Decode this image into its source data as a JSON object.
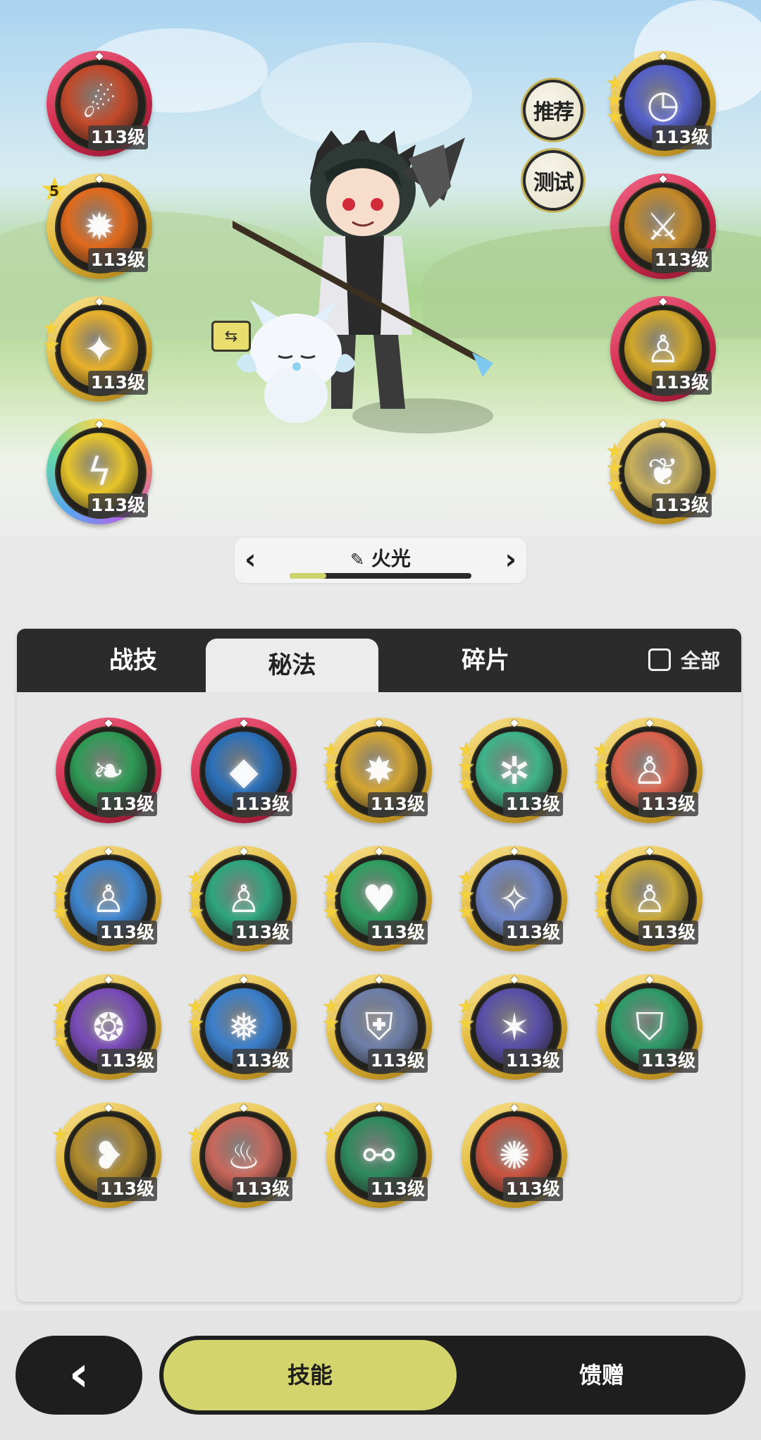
{
  "colors": {
    "accent": "#d4d46d",
    "panel_dark": "#2b2b2b",
    "gold_ring": "#e2b93b",
    "red_ring": "#d22b4e"
  },
  "scene": {
    "recommend_label": "推荐",
    "test_label": "测试",
    "swap_icon": "swap-icon"
  },
  "equipped_left": [
    {
      "level": "113级",
      "frame": "red",
      "stars": 0,
      "icon": "meteor-icon"
    },
    {
      "level": "113级",
      "frame": "gold",
      "stars": 0,
      "badge": "5",
      "icon": "fire-burst-icon"
    },
    {
      "level": "113级",
      "frame": "gold",
      "stars": 2,
      "icon": "star-lance-icon"
    },
    {
      "level": "113级",
      "frame": "rainbow",
      "stars": 0,
      "icon": "lightning-orb-icon"
    }
  ],
  "equipped_right": [
    {
      "level": "113级",
      "frame": "gold",
      "stars": 3,
      "icon": "clock-icon"
    },
    {
      "level": "113级",
      "frame": "red",
      "stars": 0,
      "icon": "sword-slash-icon"
    },
    {
      "level": "113级",
      "frame": "red",
      "stars": 0,
      "icon": "buff-figure-icon"
    },
    {
      "level": "113级",
      "frame": "gold",
      "stars": 3,
      "icon": "feather-icon"
    }
  ],
  "loadout": {
    "name": "火光",
    "edit_icon": "pencil-icon",
    "progress": 0.2
  },
  "tabs": [
    "战技",
    "秘法",
    "碎片"
  ],
  "active_tab": 1,
  "filter_label": "全部",
  "grid": [
    {
      "level": "113级",
      "frame": "red",
      "stars": 0,
      "icon": "leaf-slash-icon",
      "color": "#2f9a55"
    },
    {
      "level": "113级",
      "frame": "red",
      "stars": 0,
      "icon": "crystal-icon",
      "color": "#2b6fb8"
    },
    {
      "level": "113级",
      "frame": "gold",
      "stars": 3,
      "icon": "burst-icon",
      "color": "#d4a532"
    },
    {
      "level": "113级",
      "frame": "gold",
      "stars": 3,
      "icon": "swirl-star-icon",
      "color": "#3fb38a"
    },
    {
      "level": "113级",
      "frame": "gold",
      "stars": 3,
      "icon": "fire-figure-icon",
      "color": "#d9634d"
    },
    {
      "level": "113级",
      "frame": "gold",
      "stars": 3,
      "icon": "frost-figure-icon",
      "color": "#3f86d1"
    },
    {
      "level": "113级",
      "frame": "gold",
      "stars": 3,
      "icon": "wind-figure-icon",
      "color": "#2fa57e"
    },
    {
      "level": "113级",
      "frame": "gold",
      "stars": 3,
      "icon": "heart-icon",
      "color": "#2f9e60"
    },
    {
      "level": "113级",
      "frame": "gold",
      "stars": 3,
      "icon": "sparkle-icon",
      "color": "#6f87c9"
    },
    {
      "level": "113级",
      "frame": "gold",
      "stars": 3,
      "icon": "golden-figure-icon",
      "color": "#c9a93a"
    },
    {
      "level": "113级",
      "frame": "gold",
      "stars": 3,
      "icon": "vortex-icon",
      "color": "#7a4bb8"
    },
    {
      "level": "113级",
      "frame": "gold",
      "stars": 2,
      "icon": "ice-shard-icon",
      "color": "#3b7fcb"
    },
    {
      "level": "113级",
      "frame": "gold",
      "stars": 2,
      "icon": "armor-icon",
      "color": "#6e7fa8"
    },
    {
      "level": "113级",
      "frame": "gold",
      "stars": 2,
      "icon": "starfield-icon",
      "color": "#5a4fa8"
    },
    {
      "level": "113级",
      "frame": "gold",
      "stars": 1,
      "icon": "shield-icon",
      "color": "#2f9a6a"
    },
    {
      "level": "113级",
      "frame": "gold",
      "stars": 1,
      "icon": "golden-wing-icon",
      "color": "#b08a2e"
    },
    {
      "level": "113级",
      "frame": "gold",
      "stars": 1,
      "icon": "flame-wave-icon",
      "color": "#c9685c"
    },
    {
      "level": "113级",
      "frame": "gold",
      "stars": 1,
      "icon": "chain-icon",
      "color": "#2f8a5f"
    },
    {
      "level": "113级",
      "frame": "gold",
      "stars": 0,
      "icon": "fire-swirl-icon",
      "color": "#c9543f"
    }
  ],
  "bottom_nav": {
    "back_icon": "back-chevron-icon",
    "options": [
      "技能",
      "馈赠"
    ],
    "active": 0
  }
}
